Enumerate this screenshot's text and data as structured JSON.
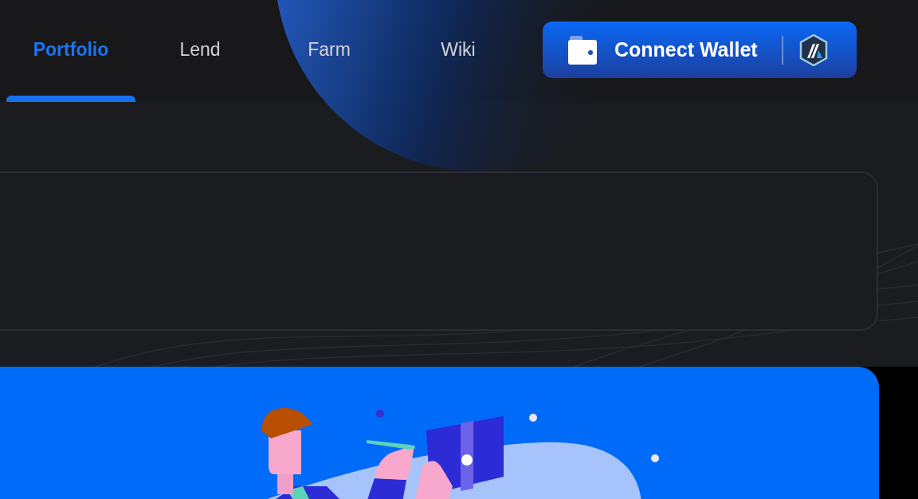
{
  "nav": {
    "tabs": [
      {
        "label": "Portfolio",
        "selected": true
      },
      {
        "label": "Lend",
        "selected": false
      },
      {
        "label": "Farm",
        "selected": false
      },
      {
        "label": "Wiki",
        "selected": false
      }
    ]
  },
  "wallet_button": {
    "label": "Connect Wallet"
  }
}
